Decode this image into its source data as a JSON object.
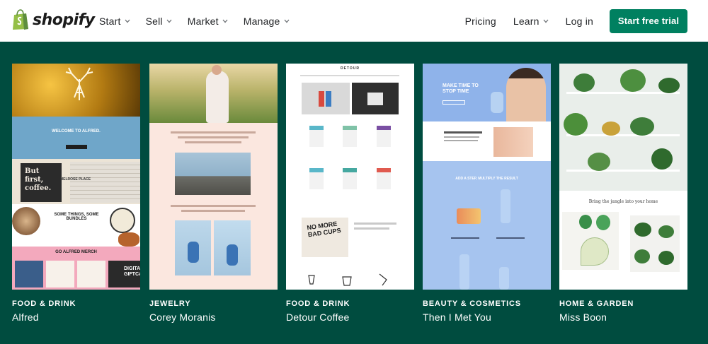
{
  "header": {
    "logo_text": "shopify",
    "nav": [
      {
        "label": "Start"
      },
      {
        "label": "Sell"
      },
      {
        "label": "Market"
      },
      {
        "label": "Manage"
      }
    ],
    "pricing": "Pricing",
    "learn": "Learn",
    "login": "Log in",
    "cta": "Start free trial"
  },
  "showcase": [
    {
      "category": "FOOD & DRINK",
      "name": "Alfred",
      "thumb": {
        "welcome": "WELCOME TO ALFRED.",
        "but": "But first, coffee.",
        "melrose": "MELROSE PLACE",
        "some": "SOME THINGS, SOME BUNDLES",
        "merch": "GO ALFRED MERCH",
        "digital": "DIGITAL GIFTCARDS"
      }
    },
    {
      "category": "JEWELRY",
      "name": "Corey Moranis"
    },
    {
      "category": "FOOD & DRINK",
      "name": "Detour Coffee",
      "thumb": {
        "brand": "DETOUR",
        "bad": "NO MORE BAD CUPS"
      }
    },
    {
      "category": "BEAUTY & COSMETICS",
      "name": "Then I Met You",
      "thumb": {
        "headline": "MAKE TIME TO STOP TIME",
        "mid": "ADD A STEP, MULTIPLY THE RESULT"
      }
    },
    {
      "category": "HOME & GARDEN",
      "name": "Miss Boon",
      "thumb": {
        "caption": "Bring the jungle into your home"
      }
    }
  ],
  "colors": {
    "brand_green": "#008060",
    "stage_bg": "#004c3f"
  }
}
